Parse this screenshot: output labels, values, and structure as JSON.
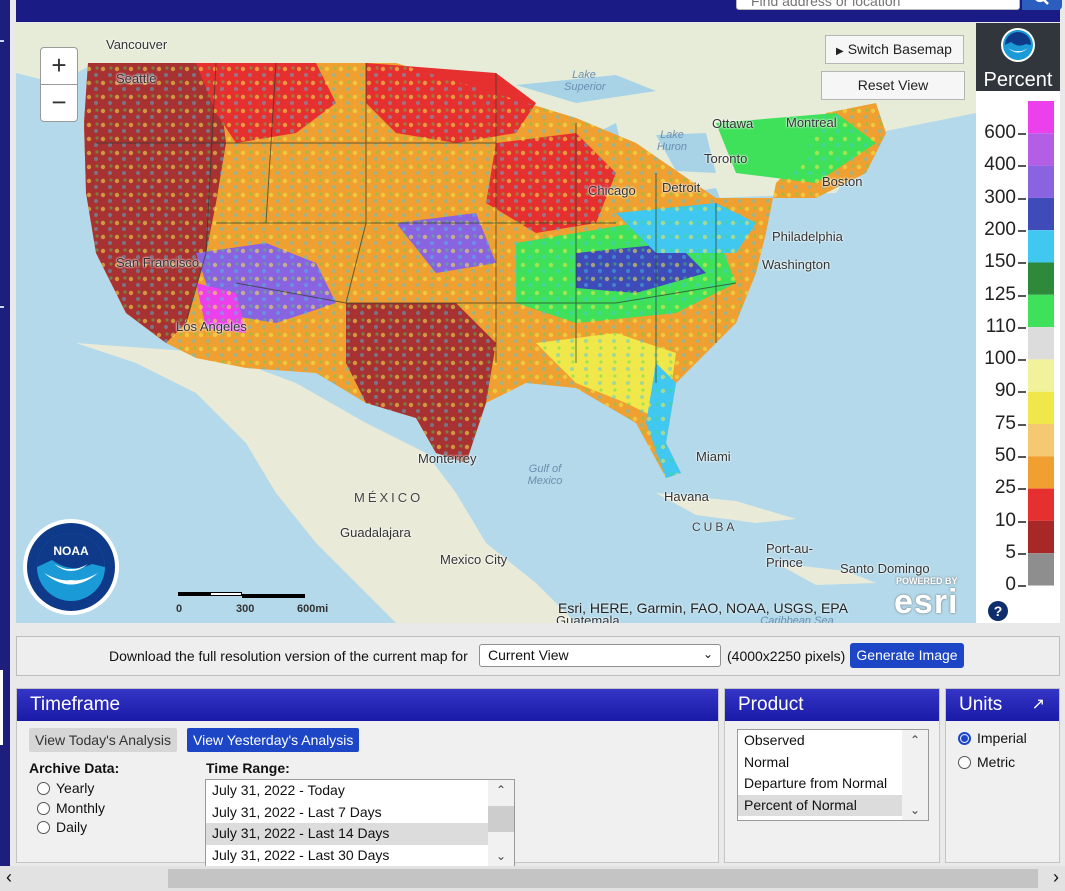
{
  "search": {
    "placeholder": "Find address or location"
  },
  "map": {
    "switch_basemap_label": "Switch Basemap",
    "reset_view_label": "Reset View",
    "zoom_in": "+",
    "zoom_out": "−",
    "attribution": "Esri, HERE, Garmin, FAO, NOAA, USGS, EPA",
    "esri_powered": "POWERED BY",
    "esri_logo": "esri",
    "scale_labels": [
      "0",
      "300",
      "600mi"
    ],
    "cities": [
      "Vancouver",
      "Seattle",
      "Lake Superior",
      "Ottawa",
      "Montreal",
      "Lake Huron",
      "Toronto",
      "Chicago",
      "Detroit",
      "Boston",
      "Philadelphia",
      "Washington",
      "San Francisco",
      "Los Angeles",
      "Monterrey",
      "Gulf of Mexico",
      "Miami",
      "Havana",
      "MÉXICO",
      "CUBA",
      "Guadalajara",
      "Mexico City",
      "Port-au-Prince",
      "Santo Domingo",
      "Guatemala",
      "Caribbean Sea"
    ],
    "logo_text": "NOAA"
  },
  "legend": {
    "title": "Percent",
    "labels": [
      "600",
      "400",
      "300",
      "200",
      "150",
      "125",
      "110",
      "100",
      "90",
      "75",
      "50",
      "25",
      "10",
      "5",
      "0"
    ],
    "colors": [
      "#ec40ec",
      "#b45ee6",
      "#8a63e0",
      "#3e4bb8",
      "#40c8f0",
      "#2e8a3a",
      "#3fe05a",
      "#dcdcdc",
      "#f2f29c",
      "#f0e84a",
      "#f5c872",
      "#f0a030",
      "#e63030",
      "#a82828",
      "#8e8e8e"
    ]
  },
  "download": {
    "text": "Download the full resolution version of the current map for",
    "select_value": "Current View",
    "pixels": "(4000x2250 pixels)",
    "button": "Generate Image"
  },
  "timeframe": {
    "title": "Timeframe",
    "today_button": "View Today's Analysis",
    "yesterday_button": "View Yesterday's Analysis",
    "archive_label": "Archive Data:",
    "archive_options": [
      "Yearly",
      "Monthly",
      "Daily"
    ],
    "range_label": "Time Range:",
    "ranges": [
      "July 31, 2022 - Today",
      "July 31, 2022 - Last 7 Days",
      "July 31, 2022 - Last 14 Days",
      "July 31, 2022 - Last 30 Days"
    ],
    "selected_range": "July 31, 2022 - Last 14 Days"
  },
  "product": {
    "title": "Product",
    "options": [
      "Observed",
      "Normal",
      "Departure from Normal",
      "Percent of Normal"
    ],
    "selected": "Percent of Normal"
  },
  "units": {
    "title": "Units",
    "options": [
      "Imperial",
      "Metric"
    ],
    "selected": "Imperial"
  }
}
